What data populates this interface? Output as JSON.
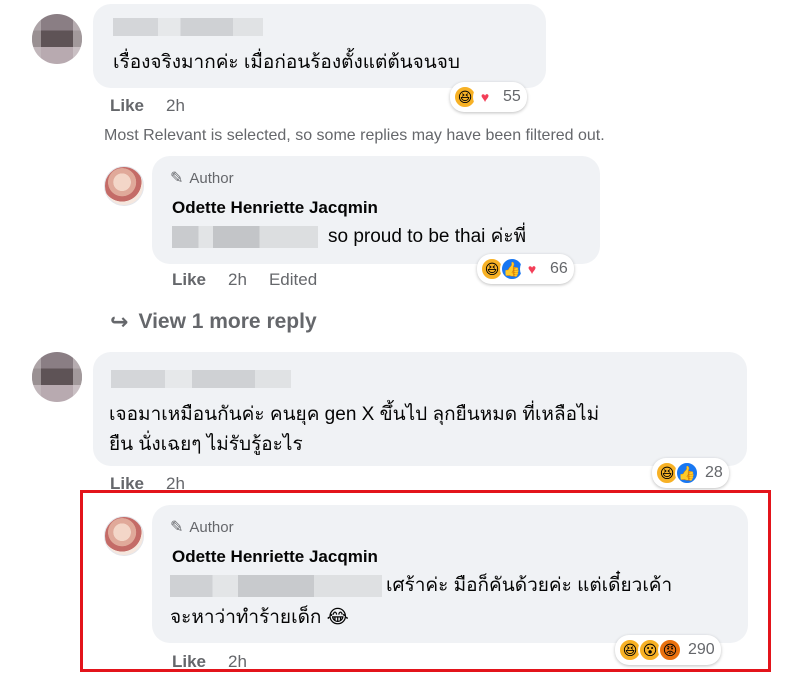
{
  "comments": [
    {
      "id": "c1",
      "text": "เรื่องจริงมากค่ะ เมื่อก่อนร้องตั้งแต่ต้นจนจบ",
      "like_label": "Like",
      "time": "2h",
      "reaction_count": "55",
      "reaction_icons": [
        "haha-icon",
        "love-icon"
      ]
    },
    {
      "id": "c2",
      "text_line1": "เจอมาเหมือนกันค่ะ คนยุค gen X ขึ้นไป ลุกยืนหมด ที่เหลือไม่",
      "text_line2": "ยืน นั่งเฉยๆ ไม่รับรู้อะไร",
      "like_label": "Like",
      "time": "2h",
      "reaction_count": "28",
      "reaction_icons": [
        "haha-icon",
        "like-icon"
      ]
    }
  ],
  "filtered_notice": "Most Relevant is selected, so some replies may have been filtered out.",
  "replies": [
    {
      "id": "r1",
      "author_badge": "Author",
      "name": "Odette Henriette Jacqmin",
      "text": "so proud to be thai ค่ะพี่",
      "like_label": "Like",
      "time": "2h",
      "edited_label": "Edited",
      "reaction_count": "66",
      "reaction_icons": [
        "haha-icon",
        "like-icon",
        "love-icon"
      ]
    },
    {
      "id": "r2",
      "author_badge": "Author",
      "name": "Odette Henriette Jacqmin",
      "text_line1": "เศร้าค่ะ มือก็คันด้วยค่ะ แต่เดี๋ยวเค้า",
      "text_line2": "จะหาว่าทำร้ายเด็ก 😂",
      "like_label": "Like",
      "time": "2h",
      "reaction_count": "290",
      "reaction_icons": [
        "haha-icon",
        "wow-icon",
        "angry-icon"
      ]
    }
  ],
  "view_more": {
    "label": "View 1 more reply",
    "icon": "reply-arrow-icon"
  },
  "colors": {
    "bubble": "#f0f2f5",
    "secondary_text": "#65676b",
    "highlight_border": "#e3141b",
    "like_blue": "#1877f2",
    "haha_yellow": "#f7b125"
  }
}
